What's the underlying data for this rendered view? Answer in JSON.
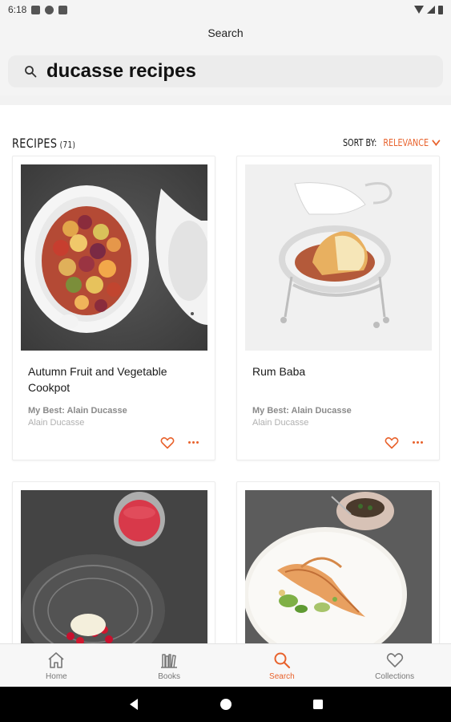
{
  "status_bar": {
    "time": "6:18"
  },
  "header": {
    "title": "Search"
  },
  "search": {
    "query": "ducasse recipes",
    "icon": "search-icon"
  },
  "results": {
    "section_title": "RECIPES",
    "count": "(71)",
    "sort_label": "SORT BY:",
    "sort_value": "RELEVANCE"
  },
  "recipes": [
    {
      "title": "Autumn Fruit and Vegetable Cookpot",
      "book": "My Best: Alain Ducasse",
      "author": "Alain Ducasse"
    },
    {
      "title": "Rum Baba",
      "book": "My Best: Alain Ducasse",
      "author": "Alain Ducasse"
    },
    {
      "title": "",
      "book": "",
      "author": ""
    },
    {
      "title": "",
      "book": "",
      "author": ""
    }
  ],
  "bottom_nav": [
    {
      "label": "Home",
      "icon": "home-icon"
    },
    {
      "label": "Books",
      "icon": "books-icon"
    },
    {
      "label": "Search",
      "icon": "search-icon",
      "active": true
    },
    {
      "label": "Collections",
      "icon": "heart-icon"
    }
  ],
  "colors": {
    "accent": "#e8622c",
    "background": "#f4f4f4"
  }
}
